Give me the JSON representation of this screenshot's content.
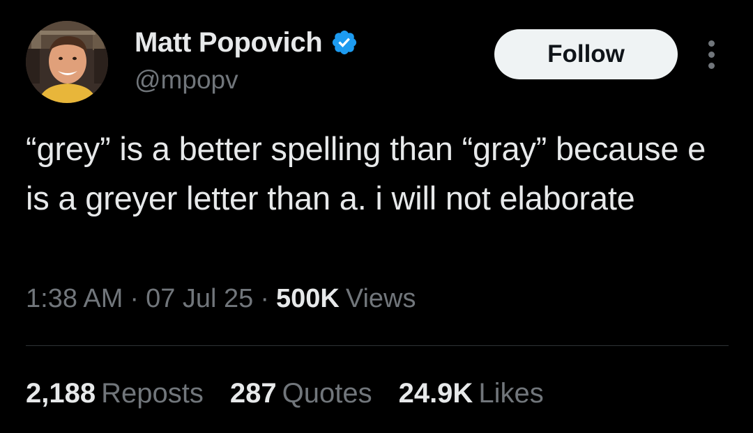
{
  "author": {
    "display_name": "Matt Popovich",
    "handle": "@mpopv",
    "verified": true
  },
  "follow_button": {
    "label": "Follow"
  },
  "more_button": {
    "icon": "more-vertical-icon"
  },
  "tweet": {
    "text": "“grey” is a better spelling than “gray” because e is a greyer letter than a. i will not elaborate"
  },
  "meta": {
    "time": "1:38 AM",
    "separator": "·",
    "date": "07 Jul 25",
    "views_count": "500K",
    "views_label": "Views"
  },
  "stats": [
    {
      "count": "2,188",
      "label": "Reposts"
    },
    {
      "count": "287",
      "label": "Quotes"
    },
    {
      "count": "24.9K",
      "label": "Likes"
    }
  ],
  "colors": {
    "background": "#000000",
    "primary_text": "#e7e9ea",
    "secondary_text": "#71767b",
    "verified_blue": "#1d9bf0",
    "follow_bg": "#eff3f4",
    "divider": "#2f3336"
  }
}
